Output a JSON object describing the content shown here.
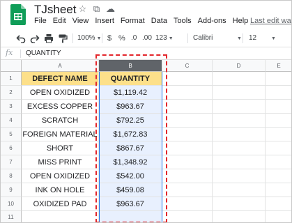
{
  "app": {
    "title": "TJsheet",
    "title_icons": [
      "star-icon",
      "move-to-folder-icon",
      "cloud-status-icon"
    ],
    "menu": [
      "File",
      "Edit",
      "View",
      "Insert",
      "Format",
      "Data",
      "Tools",
      "Add-ons",
      "Help"
    ],
    "last_edit": "Last edit was"
  },
  "toolbar": {
    "zoom": "100%",
    "currency": "$",
    "percent": "%",
    "decimal_less": ".0",
    "decimal_more": ".00",
    "more_formats": "123",
    "font": "Calibri",
    "font_size": "12"
  },
  "formula_bar": {
    "fx": "fx",
    "value": "QUANTITY"
  },
  "grid": {
    "columns": [
      "A",
      "B",
      "C",
      "D",
      "E"
    ],
    "selected_column": "B",
    "rows": [
      "1",
      "2",
      "3",
      "4",
      "5",
      "6",
      "7",
      "8",
      "9",
      "10",
      "11"
    ],
    "header": {
      "defect": "DEFECT NAME",
      "quantity": "QUANTITY"
    },
    "data": [
      {
        "defect": "OPEN OXIDIZED",
        "quantity": "$1,119.42"
      },
      {
        "defect": "EXCESS COPPER",
        "quantity": "$963.67"
      },
      {
        "defect": "SCRATCH",
        "quantity": "$792.25"
      },
      {
        "defect": "FOREIGN MATERIAL",
        "quantity": "$1,672.83"
      },
      {
        "defect": "SHORT",
        "quantity": "$867.67"
      },
      {
        "defect": "MISS PRINT",
        "quantity": "$1,348.92"
      },
      {
        "defect": "OPEN OXIDIZED",
        "quantity": "$542.00"
      },
      {
        "defect": "INK ON HOLE",
        "quantity": "$459.08"
      },
      {
        "defect": "OXIDIZED PAD",
        "quantity": "$963.67"
      }
    ]
  },
  "colors": {
    "header_fill": "#fde08a",
    "selection_fill": "#e8f0fe",
    "selection_border": "#1a73e8",
    "highlight_dash": "#e3262b",
    "logo_green": "#0f9d58"
  }
}
